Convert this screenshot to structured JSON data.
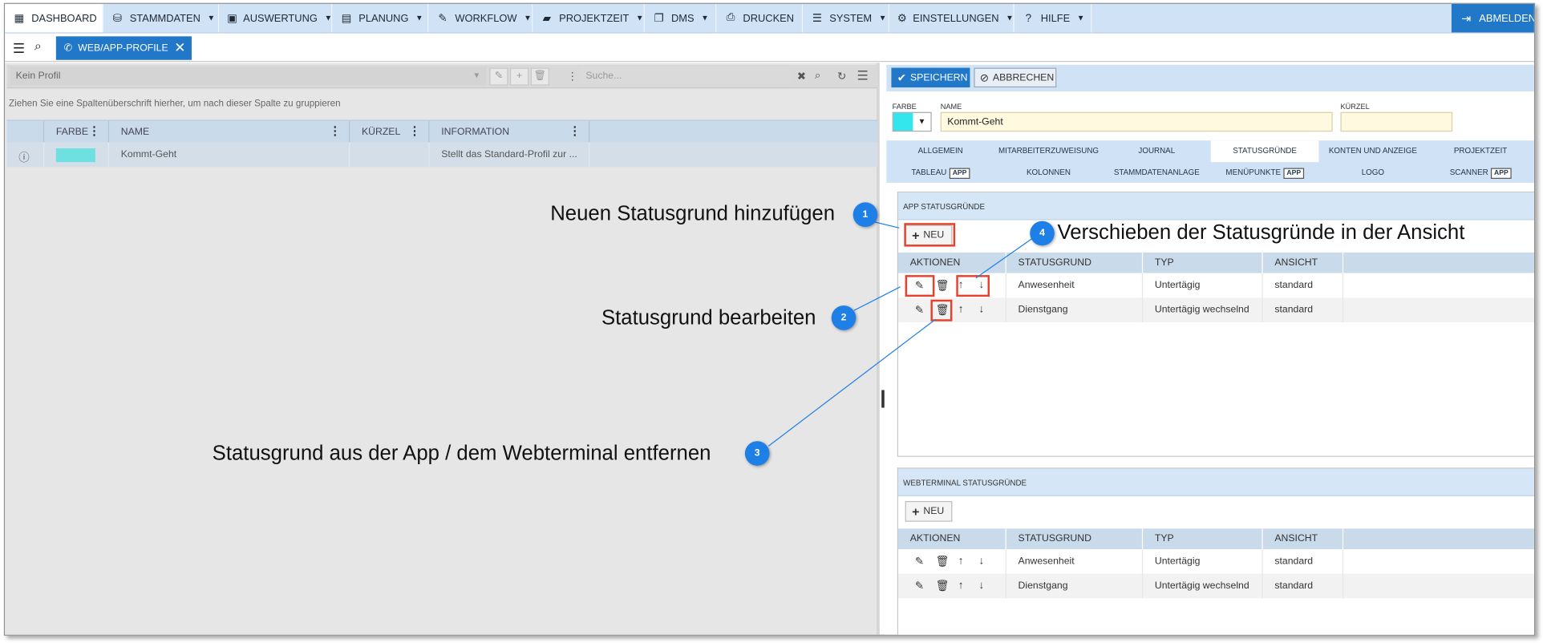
{
  "menu": {
    "items": [
      {
        "label": "DASHBOARD",
        "icon": "dashboard-grid-icon"
      },
      {
        "label": "STAMMDATEN",
        "icon": "cubes-icon"
      },
      {
        "label": "AUSWERTUNG",
        "icon": "calendar-check-icon"
      },
      {
        "label": "PLANUNG",
        "icon": "calendar-icon"
      },
      {
        "label": "WORKFLOW",
        "icon": "pencil-icon"
      },
      {
        "label": "PROJEKTZEIT",
        "icon": "briefcase-icon"
      },
      {
        "label": "DMS",
        "icon": "copy-icon"
      },
      {
        "label": "DRUCKEN",
        "icon": "printer-icon"
      },
      {
        "label": "SYSTEM",
        "icon": "server-icon"
      },
      {
        "label": "EINSTELLUNGEN",
        "icon": "gear-icon"
      },
      {
        "label": "HILFE",
        "icon": "question-icon"
      }
    ],
    "logout": "ABMELDEN"
  },
  "tabs": {
    "active": "WEB/APP-PROFILE"
  },
  "left": {
    "profile_placeholder": "Kein Profil",
    "search_placeholder": "Suche...",
    "group_hint": "Ziehen Sie eine Spaltenüberschrift hierher, um nach dieser Spalte zu gruppieren",
    "columns": [
      "FARBE",
      "NAME",
      "KÜRZEL",
      "INFORMATION"
    ],
    "rows": [
      {
        "farbe": "#6ee0e0",
        "name": "Kommt-Geht",
        "kuerzel": "",
        "information": "Stellt das Standard-Profil zur ..."
      }
    ]
  },
  "right": {
    "save": "SPEICHERN",
    "cancel": "ABBRECHEN",
    "labels": {
      "farbe": "FARBE",
      "name": "NAME",
      "kuerzel": "KÜRZEL"
    },
    "name_value": "Kommt-Geht",
    "color_value": "#33e6ee",
    "detail_tabs_row1": [
      "ALLGEMEIN",
      "MITARBEITERZUWEISUNG",
      "JOURNAL",
      "STATUSGRÜNDE",
      "KONTEN UND ANZEIGE",
      "PROJEKTZEIT"
    ],
    "detail_tabs_row2": [
      "TABLEAU",
      "KOLONNEN",
      "STAMMDATENANLAGE",
      "MENÜPUNKTE",
      "LOGO",
      "SCANNER"
    ],
    "badge": "APP",
    "active_tab": "STATUSGRÜNDE",
    "app_section": {
      "title": "APP STATUSGRÜNDE",
      "new": "NEU",
      "columns": [
        "AKTIONEN",
        "STATUSGRUND",
        "TYP",
        "ANSICHT"
      ],
      "rows": [
        {
          "statusgrund": "Anwesenheit",
          "typ": "Untertägig",
          "ansicht": "standard"
        },
        {
          "statusgrund": "Dienstgang",
          "typ": "Untertägig wechselnd",
          "ansicht": "standard"
        }
      ]
    },
    "web_section": {
      "title": "WEBTERMINAL STATUSGRÜNDE",
      "new": "NEU",
      "columns": [
        "AKTIONEN",
        "STATUSGRUND",
        "TYP",
        "ANSICHT"
      ],
      "rows": [
        {
          "statusgrund": "Anwesenheit",
          "typ": "Untertägig",
          "ansicht": "standard"
        },
        {
          "statusgrund": "Dienstgang",
          "typ": "Untertägig wechselnd",
          "ansicht": "standard"
        }
      ]
    }
  },
  "callouts": [
    {
      "num": "1",
      "text": "Neuen Statusgrund hinzufügen"
    },
    {
      "num": "2",
      "text": "Statusgrund bearbeiten"
    },
    {
      "num": "3",
      "text": "Statusgrund aus der App / dem Webterminal entfernen"
    },
    {
      "num": "4",
      "text": "Verschieben der Statusgründe in der Ansicht"
    }
  ],
  "colors": {
    "accent": "#2177c8",
    "highlight": "#e8402a",
    "callout": "#1e7fe6",
    "menu_bg": "#cfe2f6"
  }
}
